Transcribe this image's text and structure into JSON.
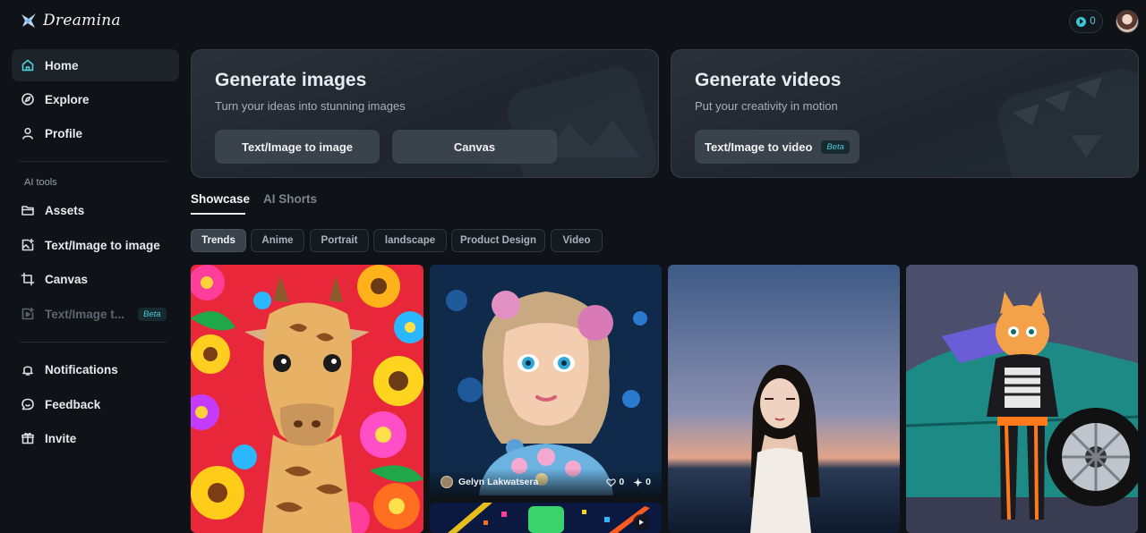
{
  "app": {
    "name": "Dreamina"
  },
  "sidebar": {
    "nav": [
      {
        "label": "Home",
        "icon": "home-icon",
        "active": true
      },
      {
        "label": "Explore",
        "icon": "compass-icon"
      },
      {
        "label": "Profile",
        "icon": "user-icon"
      }
    ],
    "section_label": "AI tools",
    "tools": [
      {
        "label": "Assets",
        "icon": "folder-icon"
      },
      {
        "label": "Text/Image to image",
        "icon": "image-plus-icon"
      },
      {
        "label": "Canvas",
        "icon": "crop-icon"
      },
      {
        "label": "Text/Image t...",
        "icon": "video-plus-icon",
        "badge": "Beta",
        "disabled": true
      }
    ],
    "bottom": [
      {
        "label": "Notifications",
        "icon": "bell-icon"
      },
      {
        "label": "Feedback",
        "icon": "chat-icon"
      },
      {
        "label": "Invite",
        "icon": "gift-icon"
      }
    ]
  },
  "header": {
    "credits": "0"
  },
  "generate_images": {
    "title": "Generate images",
    "subtitle": "Turn your ideas into stunning images",
    "buttons": [
      "Text/Image to image",
      "Canvas"
    ]
  },
  "generate_videos": {
    "title": "Generate videos",
    "subtitle": "Put your creativity in motion",
    "button": "Text/Image to video",
    "badge": "Beta"
  },
  "tabs": [
    {
      "label": "Showcase",
      "active": true
    },
    {
      "label": "AI Shorts",
      "active": false
    }
  ],
  "chips": [
    {
      "label": "Trends",
      "active": true
    },
    {
      "label": "Anime"
    },
    {
      "label": "Portrait"
    },
    {
      "label": "landscape"
    },
    {
      "label": "Product Design"
    },
    {
      "label": "Video"
    }
  ],
  "gallery": {
    "featured": {
      "author": "Gelyn Lakwatsera",
      "likes": "0",
      "remixes": "0"
    }
  },
  "colors": {
    "accent": "#4fd1d9",
    "background": "#0f1318",
    "card": "#222a32"
  }
}
